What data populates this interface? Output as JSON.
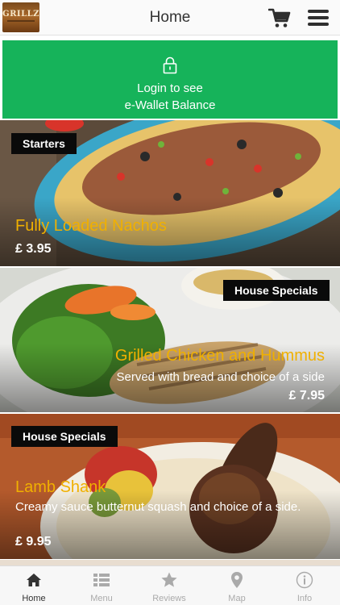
{
  "header": {
    "logo_text": "GRILLZ",
    "title": "Home",
    "cart_icon": "cart-icon",
    "menu_icon": "hamburger-menu-icon"
  },
  "login_banner": {
    "icon": "lock-icon",
    "line1": "Login to see",
    "line2": "e-Wallet Balance",
    "color": "#16b35a"
  },
  "cards": [
    {
      "tag": "Starters",
      "title": "Fully Loaded Nachos",
      "description": "",
      "price": "£ 3.95"
    },
    {
      "tag": "House Specials",
      "title": "Grilled Chicken and Hummus",
      "description": "Served with bread and choice of a side",
      "price": "£ 7.95"
    },
    {
      "tag": "House Specials",
      "title": "Lamb Shank",
      "description": "Creamy sauce butternut squash and choice of a side.",
      "price": "£ 9.95"
    }
  ],
  "tabs": [
    {
      "label": "Home",
      "icon": "home-icon",
      "active": true
    },
    {
      "label": "Menu",
      "icon": "list-icon",
      "active": false
    },
    {
      "label": "Reviews",
      "icon": "star-icon",
      "active": false
    },
    {
      "label": "Map",
      "icon": "map-pin-icon",
      "active": false
    },
    {
      "label": "Info",
      "icon": "info-icon",
      "active": false
    }
  ],
  "colors": {
    "accent_green": "#16b35a",
    "title_yellow": "#f0b000",
    "tag_black": "#0a0a0a"
  }
}
